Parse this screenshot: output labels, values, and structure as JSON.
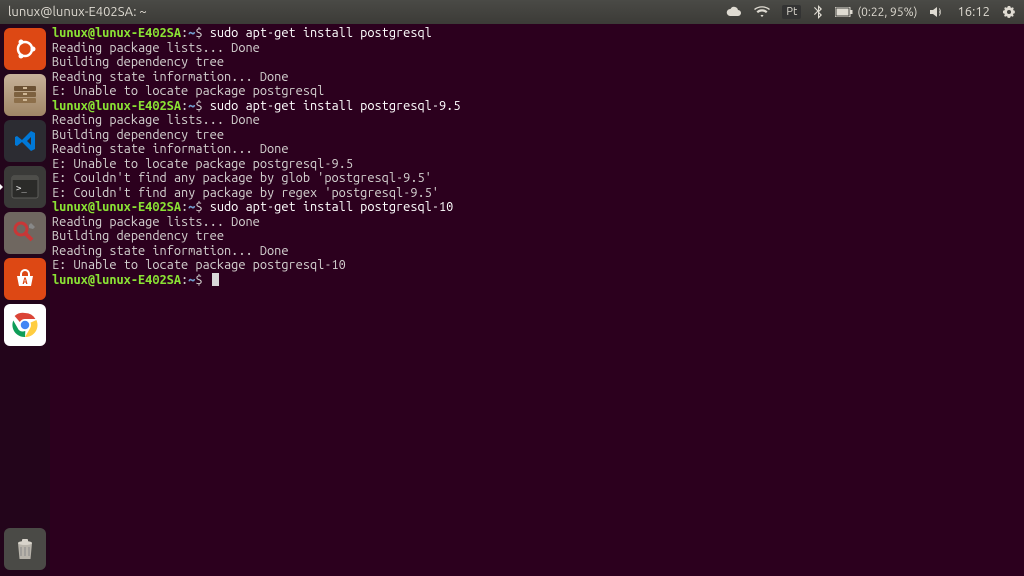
{
  "topbar": {
    "title": "lunux@lunux-E402SA: ~",
    "keyboard_layout": "Pt",
    "battery_text": "(0:22, 95%)",
    "clock": "16:12"
  },
  "launcher": {
    "items": [
      {
        "name": "ubuntu-dash",
        "label": "Dash"
      },
      {
        "name": "files",
        "label": "Files"
      },
      {
        "name": "vscode",
        "label": "Visual Studio Code"
      },
      {
        "name": "terminal",
        "label": "Terminal",
        "active": true
      },
      {
        "name": "settings",
        "label": "Settings"
      },
      {
        "name": "software-center",
        "label": "Ubuntu Software"
      },
      {
        "name": "chrome",
        "label": "Google Chrome"
      }
    ],
    "trash": {
      "name": "trash",
      "label": "Trash"
    }
  },
  "terminal": {
    "prompt_user": "lunux@lunux-E402SA",
    "prompt_sep": ":",
    "prompt_path": "~",
    "prompt_end": "$ ",
    "blocks": [
      {
        "command": "sudo apt-get install postgresql",
        "output": [
          "Reading package lists... Done",
          "Building dependency tree       ",
          "Reading state information... Done",
          "E: Unable to locate package postgresql"
        ]
      },
      {
        "command": "sudo apt-get install postgresql-9.5",
        "output": [
          "Reading package lists... Done",
          "Building dependency tree       ",
          "Reading state information... Done",
          "E: Unable to locate package postgresql-9.5",
          "E: Couldn't find any package by glob 'postgresql-9.5'",
          "E: Couldn't find any package by regex 'postgresql-9.5'"
        ]
      },
      {
        "command": "sudo apt-get install postgresql-10",
        "output": [
          "Reading package lists... Done",
          "Building dependency tree       ",
          "Reading state information... Done",
          "E: Unable to locate package postgresql-10"
        ]
      }
    ],
    "current_command": ""
  }
}
